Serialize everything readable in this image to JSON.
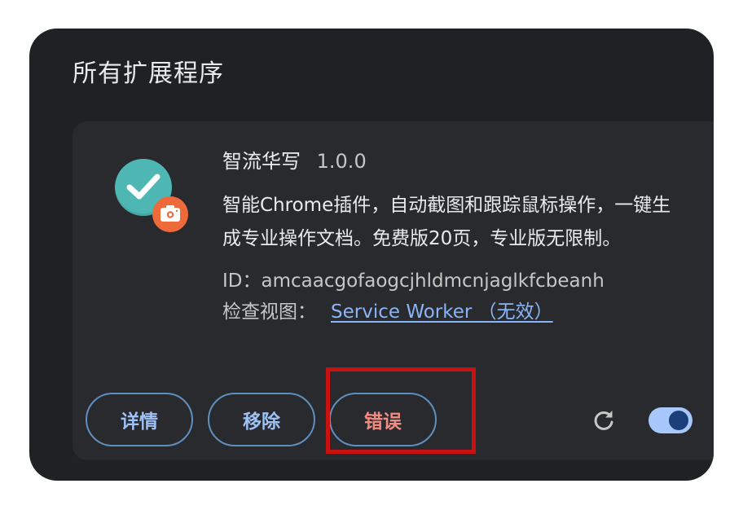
{
  "section": {
    "title": "所有扩展程序"
  },
  "extension": {
    "name": "智流华写",
    "version": "1.0.0",
    "description": "智能Chrome插件，自动截图和跟踪鼠标操作，一键生成专业操作文档。免费版20页，专业版无限制。",
    "id_label": "ID：",
    "id_value": "amcaacgofaogcjhldmcnjaglkfcbeanh",
    "inspect_label": "检查视图：",
    "inspect_link": "Service Worker （无效）",
    "icon": "teal-checkmark-with-camera-badge",
    "enabled": true
  },
  "buttons": {
    "details": "详情",
    "remove": "移除",
    "errors": "错误"
  },
  "icons": {
    "reload": "reload-icon",
    "toggle": "toggle-switch"
  },
  "colors": {
    "background": "#202124",
    "card": "#292a2d",
    "accent": "#8ab4f8",
    "error": "#f28b82",
    "highlight": "#c81111"
  }
}
